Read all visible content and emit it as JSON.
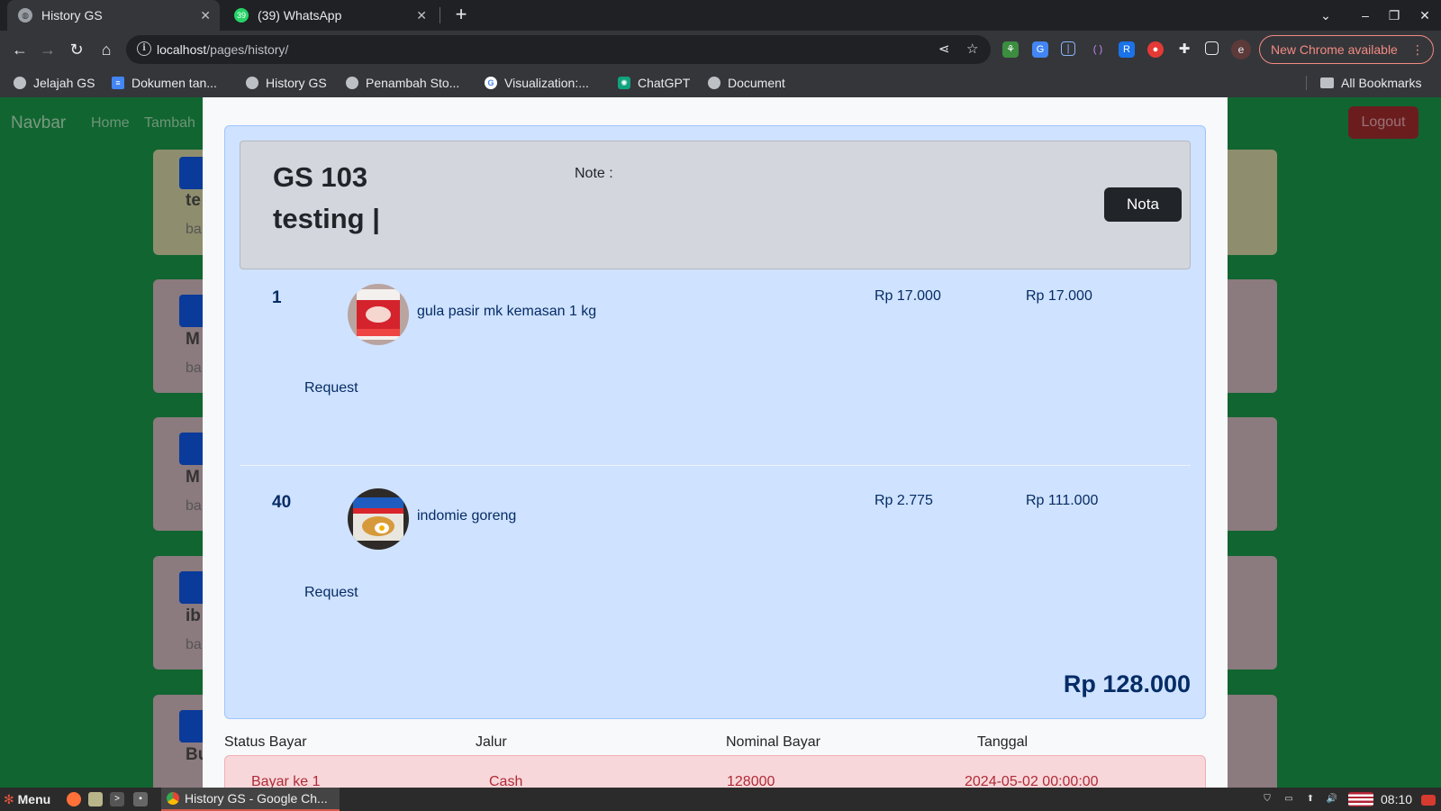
{
  "browser": {
    "tabs": [
      {
        "title": "History GS",
        "active": true
      },
      {
        "title": "(39) WhatsApp",
        "active": false,
        "badge": "39"
      }
    ],
    "address": {
      "host": "localhost",
      "path": "/pages/history/"
    },
    "update_button": "New Chrome available",
    "profile_initial": "e",
    "bookmarks": [
      {
        "label": "Jelajah GS",
        "icon": "globe-icon"
      },
      {
        "label": "Dokumen tan...",
        "icon": "docs-icon"
      },
      {
        "label": "History GS",
        "icon": "globe-icon"
      },
      {
        "label": "Penambah Sto...",
        "icon": "globe-icon"
      },
      {
        "label": "Visualization:...",
        "icon": "google-icon"
      },
      {
        "label": "ChatGPT",
        "icon": "chatgpt-icon"
      },
      {
        "label": "Document",
        "icon": "globe-icon"
      }
    ],
    "all_bookmarks": "All Bookmarks"
  },
  "navbar": {
    "brand": "Navbar",
    "links": [
      "Home",
      "Tambah"
    ],
    "logout": "Logout"
  },
  "background_cards": [
    {
      "title": "te",
      "sub": "ba"
    },
    {
      "title": "M",
      "sub": "ba"
    },
    {
      "title": "M",
      "sub": "ba"
    },
    {
      "title": "ib",
      "sub": "ba"
    },
    {
      "title": "Bu",
      "sub": ""
    }
  ],
  "order": {
    "code": "GS 103",
    "customer": "testing |",
    "note_label": "Note :",
    "nota_button": "Nota",
    "items": [
      {
        "qty": "1",
        "name": "gula pasir mk kemasan 1 kg",
        "price": "Rp 17.000",
        "subtotal": "Rp 17.000",
        "request_label": "Request"
      },
      {
        "qty": "40",
        "name": "indomie goreng",
        "price": "Rp 2.775",
        "subtotal": "Rp 111.000",
        "request_label": "Request"
      }
    ],
    "total": "Rp 128.000"
  },
  "payments": {
    "headers": [
      "Status Bayar",
      "Jalur",
      "Nominal Bayar",
      "Tanggal"
    ],
    "rows": [
      {
        "status": "Bayar ke 1",
        "method": "Cash",
        "amount": "128000",
        "date": "2024-05-02 00:00:00"
      }
    ]
  },
  "taskbar": {
    "menu": "Menu",
    "window_title": "History GS - Google Ch...",
    "clock": "08:10"
  }
}
